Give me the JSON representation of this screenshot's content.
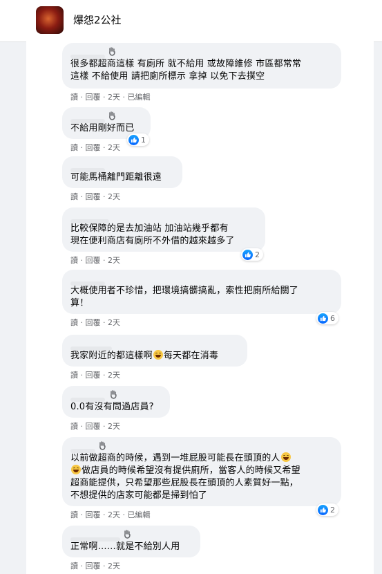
{
  "header": {
    "group_name": "爆怨2公社"
  },
  "action_labels": {
    "read": "讀",
    "reply": "回覆",
    "edited": "已編輯"
  },
  "comments": [
    {
      "text": "很多都超商這樣 有廁所 就不給用 或故障維修 市區都常常\n這樣 不給使用 請把廁所標示 拿掉 以免下去撲空",
      "time": "2天",
      "edited": true,
      "reactions": ""
    },
    {
      "text": "不給用剛好而已",
      "time": "2天",
      "edited": false,
      "reactions": "1"
    },
    {
      "text": "可能馬桶離門距離很遠",
      "time": "2天",
      "edited": false,
      "reactions": ""
    },
    {
      "text": "比較保障的是去加油站 加油站幾乎都有\n現在便利商店有廁所不外借的越來越多了",
      "time": "2天",
      "edited": false,
      "reactions": "2"
    },
    {
      "text": "大概使用者不珍惜，把環境搞髒搞亂，索性把廁所給關了\n算！",
      "time": "2天",
      "edited": false,
      "reactions": "6"
    },
    {
      "text_before": "我家附近的都這樣啊",
      "text_after": "每天都在消毒",
      "time": "2天",
      "edited": false,
      "reactions": ""
    },
    {
      "text": "0.0有沒有問過店員?",
      "time": "2天",
      "edited": false,
      "reactions": ""
    },
    {
      "line1": "以前做超商的時候，遇到一堆屁股可能長在頭頂的人",
      "line2": "做店員的時候希望沒有提供廁所，當客人的時候又希望",
      "line3": "超商能提供，只希望那些屁股長在頭頂的人素質好一點，",
      "line4": "不想提供的店家可能都是掃到怕了",
      "time": "2天",
      "edited": true,
      "reactions": "2"
    },
    {
      "text": "正常啊……就是不給別人用",
      "time": "2天",
      "edited": false,
      "reactions": ""
    }
  ]
}
